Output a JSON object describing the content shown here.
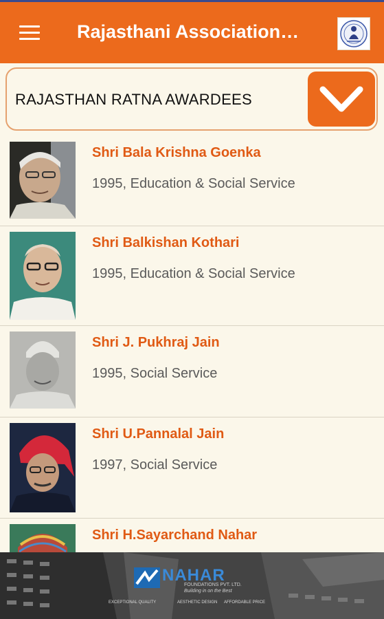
{
  "header": {
    "title": "Rajasthani Association…",
    "menu_icon": "hamburger-menu-icon",
    "logo_icon": "association-logo"
  },
  "category": {
    "selected": "RAJASTHAN RATNA AWARDEES",
    "dropdown_icon": "chevron-down-icon"
  },
  "awardees": [
    {
      "name": "Shri Bala Krishna Goenka",
      "detail": "1995, Education & Social Service"
    },
    {
      "name": "Shri Balkishan Kothari",
      "detail": "1995, Education & Social Service"
    },
    {
      "name": "Shri J. Pukhraj Jain",
      "detail": "1995, Social Service"
    },
    {
      "name": "Shri U.Pannalal Jain",
      "detail": "1997, Social Service"
    },
    {
      "name": "Shri H.Sayarchand Nahar",
      "detail": ""
    }
  ],
  "ad": {
    "brand": "NAHAR",
    "company": "FOUNDATIONS PVT. LTD.",
    "tagline": "Building in on the Best",
    "features": [
      "EXCEPTIONAL QUALITY",
      "AESTHETIC DESIGN",
      "AFFORDABLE PRICE"
    ]
  },
  "colors": {
    "accent": "#ec6a1c",
    "name_text": "#e05a14",
    "background": "#fbf7ea"
  }
}
